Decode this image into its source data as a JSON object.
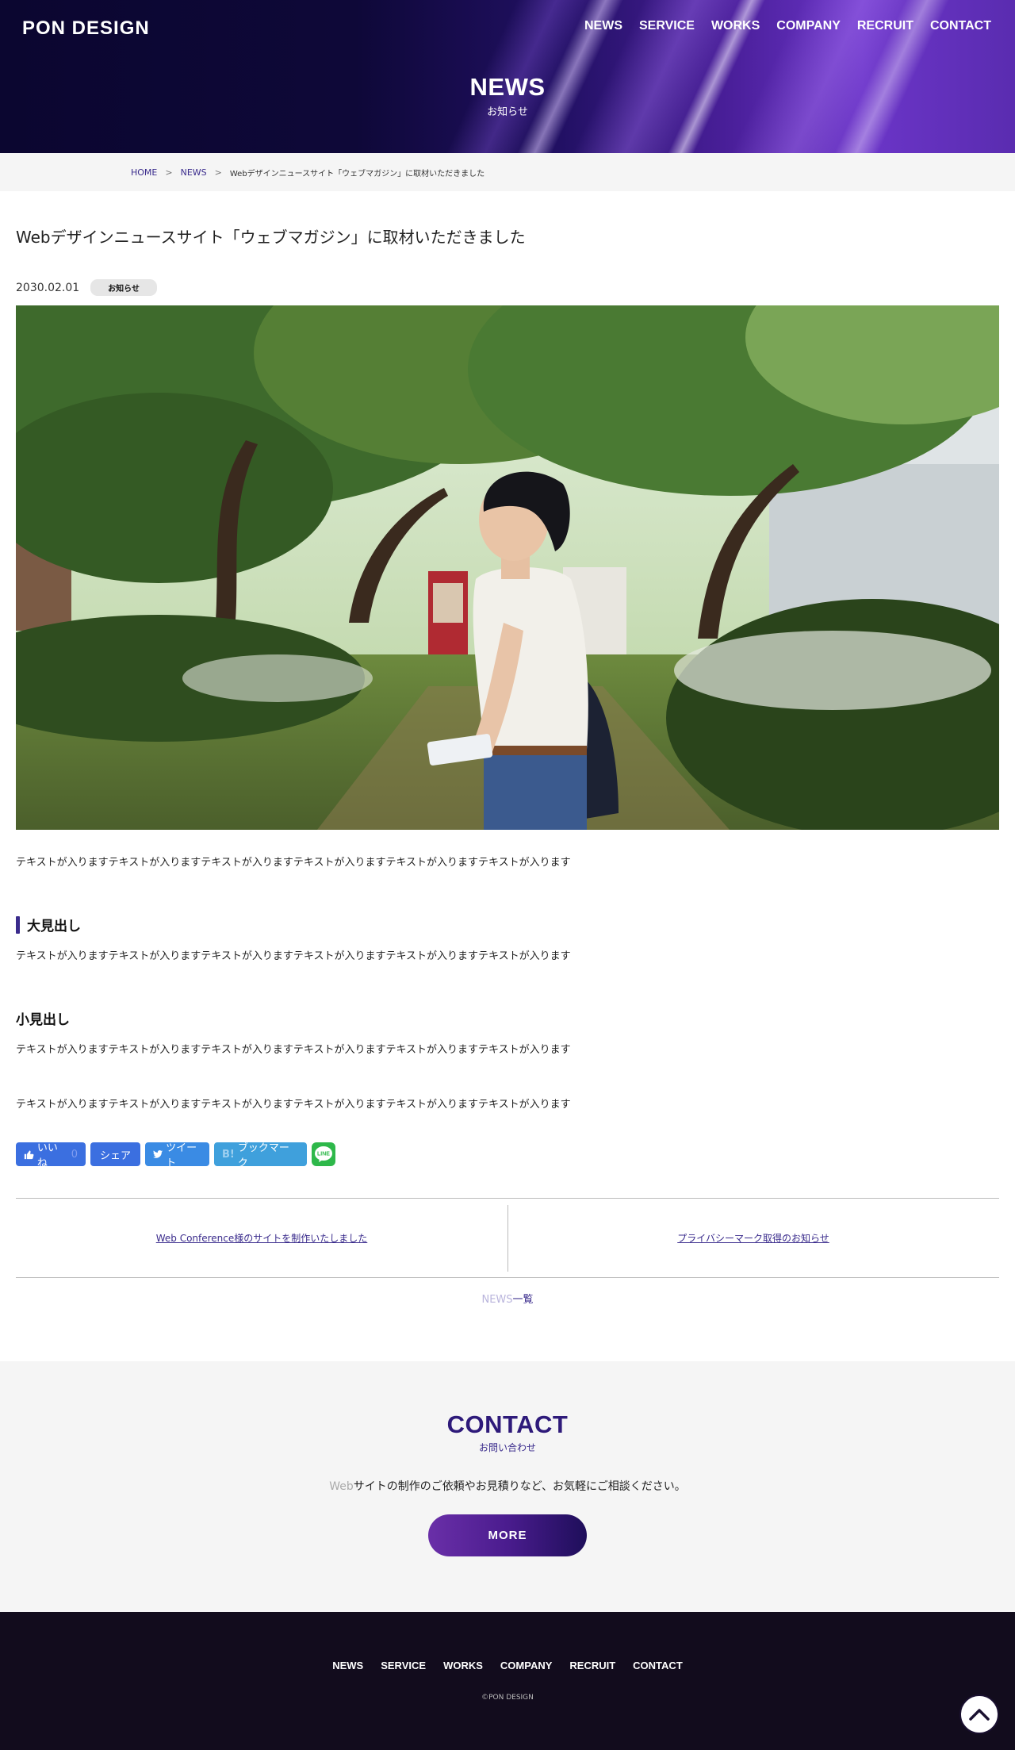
{
  "site": {
    "logo": "PON DESIGN",
    "nav": [
      "NEWS",
      "SERVICE",
      "WORKS",
      "COMPANY",
      "RECRUIT",
      "CONTACT"
    ]
  },
  "page_heading": {
    "en": "NEWS",
    "ja": "お知らせ"
  },
  "breadcrumb": {
    "home": "HOME",
    "separator": ">",
    "news": "NEWS",
    "current": "Webデザインニュースサイト「ウェブマガジン」に取材いただきました"
  },
  "article": {
    "title": "Webデザインニュースサイト「ウェブマガジン」に取材いただきました",
    "date": "2030.02.01",
    "category": "お知らせ",
    "paragraph_1": "テキストが入りますテキストが入りますテキストが入りますテキストが入りますテキストが入りますテキストが入ります",
    "heading_large": "大見出し",
    "paragraph_2": "テキストが入りますテキストが入りますテキストが入りますテキストが入りますテキストが入りますテキストが入ります",
    "heading_small": "小見出し",
    "paragraph_3": "テキストが入りますテキストが入りますテキストが入りますテキストが入りますテキストが入りますテキストが入ります",
    "paragraph_4": "テキストが入りますテキストが入りますテキストが入りますテキストが入りますテキストが入りますテキストが入ります"
  },
  "share": {
    "like_label": "いいね",
    "like_count": "0",
    "share_label": "シェア",
    "tweet_label": "ツイート",
    "hatena_b": "B!",
    "bookmark_label": "ブックマーク",
    "line_label": "LINE"
  },
  "pager": {
    "prev": "Web Conference様のサイトを制作いたしました",
    "next": "プライバシーマーク取得のお知らせ",
    "list_en": "NEWS",
    "list_ja": "一覧"
  },
  "contact": {
    "title": "CONTACT",
    "subtitle": "お問い合わせ",
    "lead_web": "Web",
    "lead_rest": "サイトの制作のご依頼やお見積りなど、お気軽にご相談ください。",
    "button": "MORE"
  },
  "footer": {
    "nav": [
      "NEWS",
      "SERVICE",
      "WORKS",
      "COMPANY",
      "RECRUIT",
      "CONTACT"
    ],
    "copyright": "©PON DESIGN"
  },
  "colors": {
    "accent": "#3a2b8c",
    "contact_title": "#2e1a7a",
    "footer_bg": "#120c1d",
    "facebook": "#3b6fe0",
    "twitter": "#3a8be4",
    "hatena": "#3fa0dc",
    "line": "#2eb84a"
  },
  "icons": {
    "like": "thumbs-up-icon",
    "twitter": "twitter-bird-icon",
    "line": "line-icon",
    "to_top": "chevron-up-icon"
  }
}
